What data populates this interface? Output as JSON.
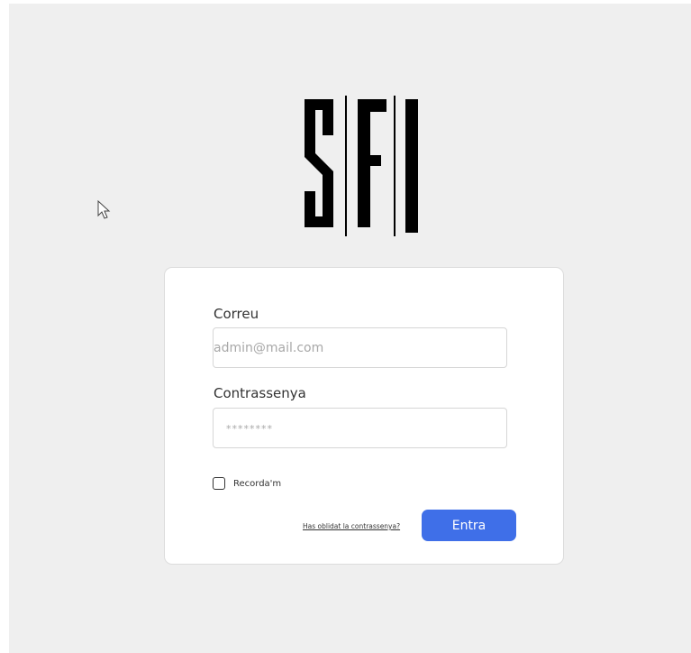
{
  "logo": {
    "text": "SFI",
    "color": "#000000"
  },
  "form": {
    "email_label": "Correu",
    "email_placeholder": "admin@mail.com",
    "password_label": "Contrassenya",
    "password_placeholder": "********",
    "remember_label": "Recorda'm",
    "forgot_link": "Has oblidat la contrassenya?",
    "submit_label": "Entra"
  },
  "colors": {
    "background": "#efefef",
    "card": "#ffffff",
    "accent": "#3f6fe8"
  }
}
